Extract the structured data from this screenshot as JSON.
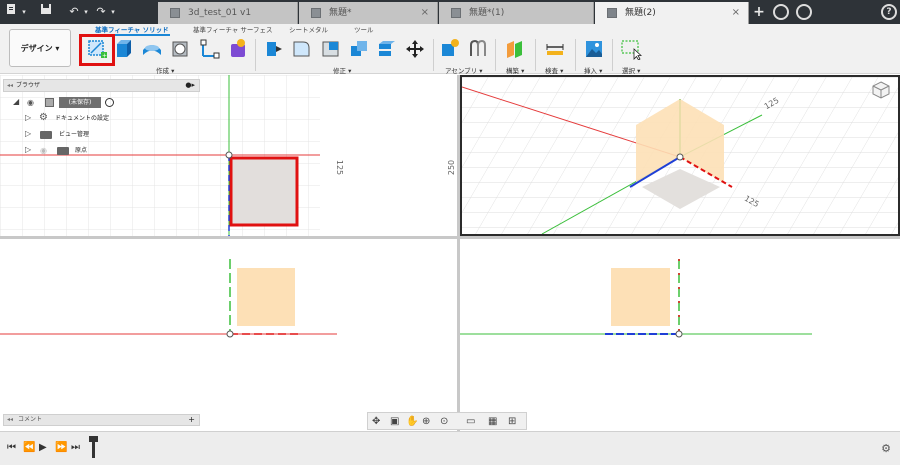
{
  "window": {
    "tabs": [
      {
        "label": "3d_test_01 v1",
        "active": false
      },
      {
        "label": "無題*",
        "active": false
      },
      {
        "label": "無題*(1)",
        "active": false
      },
      {
        "label": "無題(2)",
        "active": true
      }
    ],
    "new_tab_label": "+",
    "close_label": "×",
    "help_label": "?"
  },
  "toolbar": {
    "workspace_label": "デザイン ▾",
    "tabs": [
      "基準フィーチャ ソリッド",
      "基準フィーチャ サーフェス",
      "シートメタル",
      "ツール"
    ],
    "groups": [
      "作成 ▾",
      "修正 ▾",
      "アセンブリ ▾",
      "構築 ▾",
      "検査 ▾",
      "挿入 ▾",
      "選択 ▾"
    ],
    "highlighted_tool": "create-sketch"
  },
  "browser": {
    "title": "ブラウザ",
    "root_label": "(未保存)",
    "items": [
      "ドキュメントの設定",
      "ビュー管理",
      "原点"
    ]
  },
  "comment": {
    "title": "コメント",
    "plus": "+"
  },
  "viewports": {
    "top_dim_right": "125",
    "top_dim_right2": "250",
    "iso_dim_a": "125",
    "iso_dim_b": "125"
  },
  "colors": {
    "accent": "#1b87d6",
    "highlight": "#e01111",
    "face": "#fde0b6",
    "axis_red": "#e53b3b",
    "axis_green": "#3bbf3b",
    "axis_blue": "#1f3fd6",
    "grid": "#dcdcdc"
  }
}
